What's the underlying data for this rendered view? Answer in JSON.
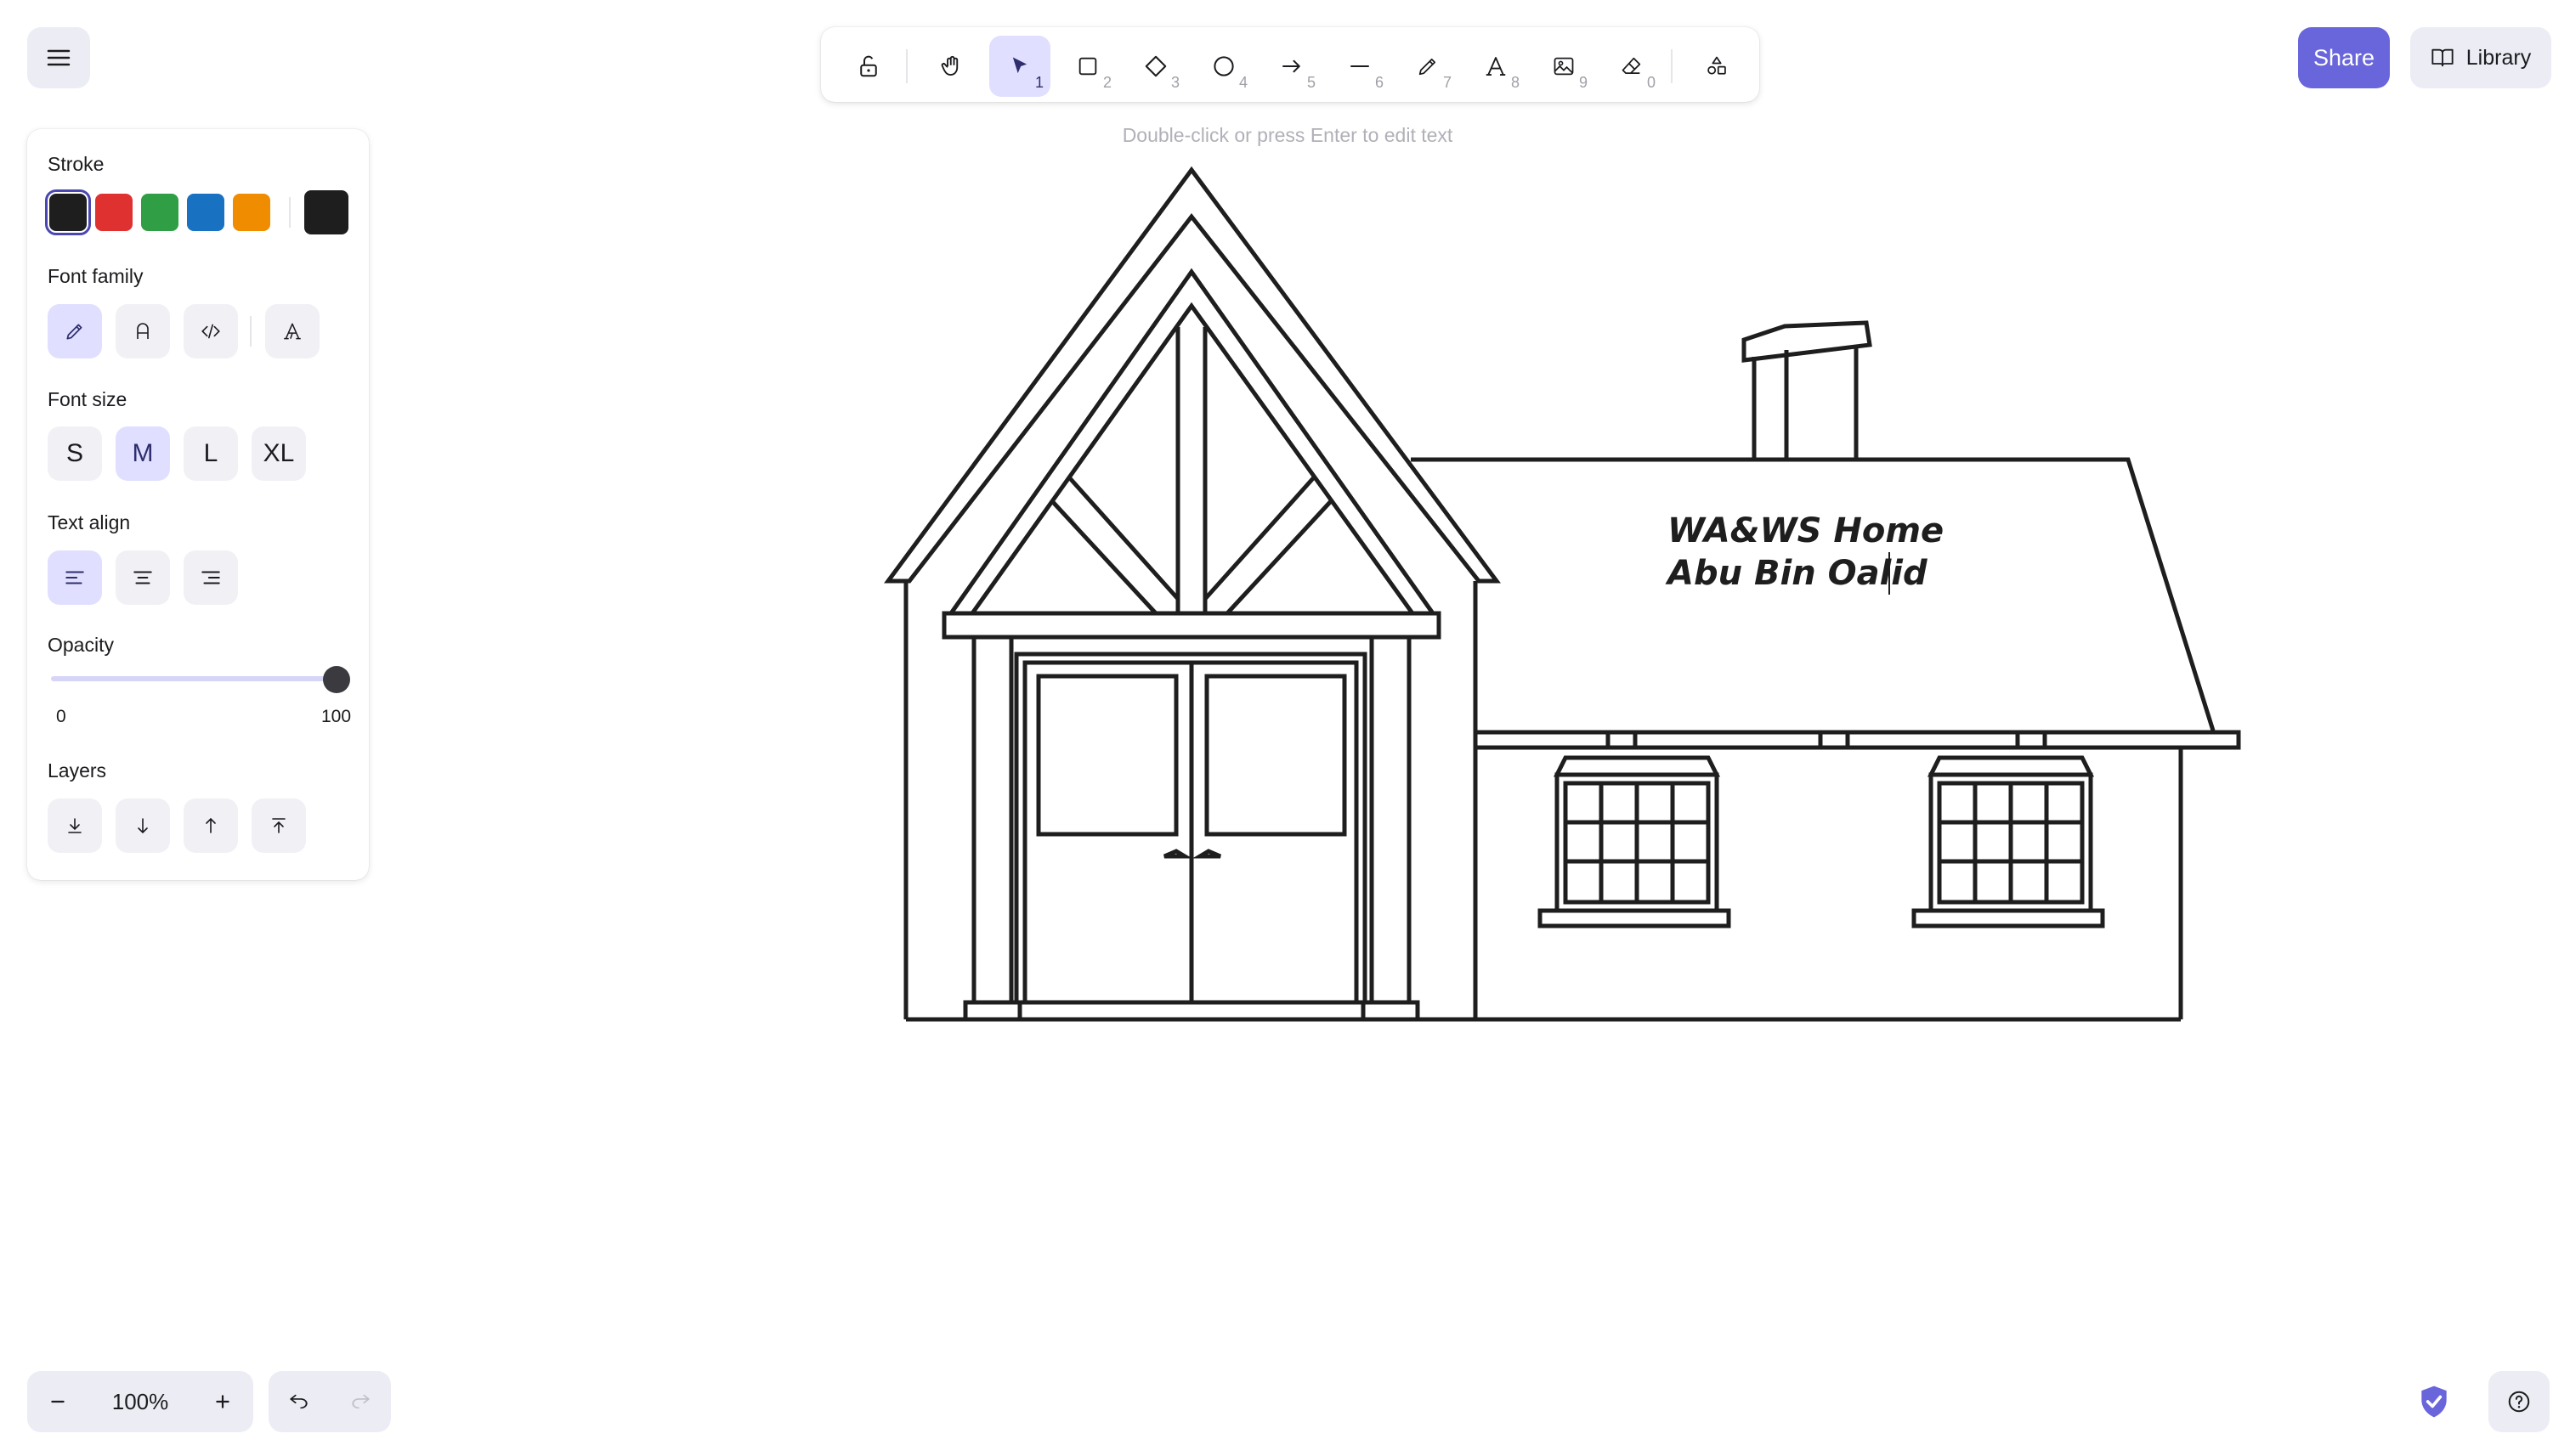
{
  "toolbar": {
    "hint": "Double-click or press Enter to edit text",
    "tools": [
      {
        "name": "lock-tool",
        "key": ""
      },
      {
        "name": "hand-tool",
        "key": ""
      },
      {
        "name": "selection-tool",
        "key": "1"
      },
      {
        "name": "rectangle-tool",
        "key": "2"
      },
      {
        "name": "diamond-tool",
        "key": "3"
      },
      {
        "name": "ellipse-tool",
        "key": "4"
      },
      {
        "name": "arrow-tool",
        "key": "5"
      },
      {
        "name": "line-tool",
        "key": "6"
      },
      {
        "name": "draw-tool",
        "key": "7"
      },
      {
        "name": "text-tool",
        "key": "8"
      },
      {
        "name": "image-tool",
        "key": "9"
      },
      {
        "name": "eraser-tool",
        "key": "0"
      },
      {
        "name": "extra-tools",
        "key": ""
      }
    ],
    "active_tool": "selection-tool"
  },
  "header": {
    "share_label": "Share",
    "library_label": "Library"
  },
  "properties": {
    "stroke_label": "Stroke",
    "stroke_colors": [
      "#1e1e1e",
      "#e03131",
      "#2f9e44",
      "#1971c2",
      "#f08c00"
    ],
    "stroke_selected": "#1e1e1e",
    "font_family_label": "Font family",
    "font_families": [
      "hand-drawn",
      "normal",
      "code",
      "excalifont"
    ],
    "font_family_selected": "hand-drawn",
    "font_size_label": "Font size",
    "font_sizes": [
      "S",
      "M",
      "L",
      "XL"
    ],
    "font_size_selected": "M",
    "text_align_label": "Text align",
    "text_align_selected": "left",
    "opacity_label": "Opacity",
    "opacity_min": "0",
    "opacity_max": "100",
    "opacity_value": 100,
    "layers_label": "Layers"
  },
  "canvas": {
    "text_line1": "WA&WS Home",
    "text_line2": "Abu Bin Oalid"
  },
  "footer": {
    "zoom_level": "100%"
  },
  "colors": {
    "accent": "#6965db",
    "active_bg": "#e0dfff",
    "button_bg": "#ececf4"
  }
}
